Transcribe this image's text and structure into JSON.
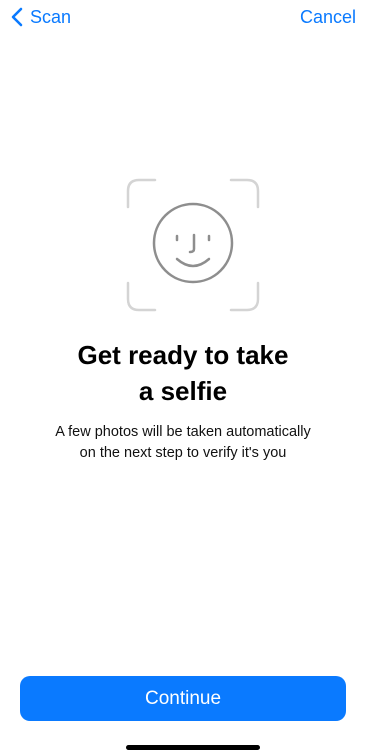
{
  "nav": {
    "back_label": "Scan",
    "cancel_label": "Cancel"
  },
  "content": {
    "title_line1": "Get ready to take",
    "title_line2": "a selfie",
    "subtitle_line1": "A few photos will be taken automatically",
    "subtitle_line2": "on the next step to verify it's you"
  },
  "footer": {
    "continue_label": "Continue"
  },
  "icons": {
    "back": "chevron-left-icon",
    "face": "smiley-face-icon",
    "frame": "face-scan-frame-icon"
  },
  "colors": {
    "accent": "#0a7aff",
    "icon_gray": "#8e8e8e",
    "frame_gray": "#d4d4d4"
  }
}
